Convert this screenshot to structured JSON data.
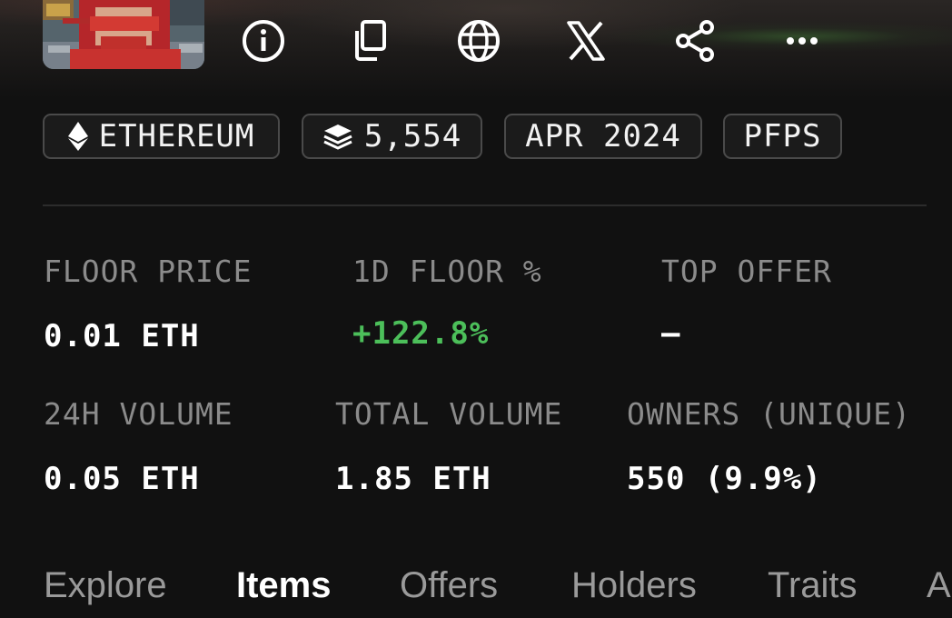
{
  "header": {
    "action_icons": [
      "info-icon",
      "copy-icon",
      "globe-icon",
      "x-logo-icon",
      "share-icon",
      "more-icon"
    ]
  },
  "chips": [
    {
      "icon": "ethereum-icon",
      "label": "ETHEREUM"
    },
    {
      "icon": "layers-icon",
      "label": "5,554"
    },
    {
      "label": "APR 2024"
    },
    {
      "label": "PFPS"
    }
  ],
  "stats": {
    "floor_price": {
      "label": "FLOOR PRICE",
      "value": "0.01 ETH"
    },
    "floor_change_1d": {
      "label": "1D FLOOR %",
      "value": "+122.8%"
    },
    "top_offer": {
      "label": "TOP OFFER",
      "value": "–"
    },
    "volume_24h": {
      "label": "24H VOLUME",
      "value": "0.05 ETH"
    },
    "total_volume": {
      "label": "TOTAL VOLUME",
      "value": "1.85 ETH"
    },
    "owners": {
      "label": "OWNERS (UNIQUE)",
      "value": "550 (9.9%)"
    }
  },
  "tabs": [
    {
      "label": "Explore",
      "active": false
    },
    {
      "label": "Items",
      "active": true
    },
    {
      "label": "Offers",
      "active": false
    },
    {
      "label": "Holders",
      "active": false
    },
    {
      "label": "Traits",
      "active": false
    },
    {
      "label": "A",
      "active": false
    }
  ],
  "colors": {
    "background": "#111111",
    "positive": "#4cbf5a",
    "muted_label": "#8b8b8b",
    "chip_border": "#4a4a4a"
  }
}
